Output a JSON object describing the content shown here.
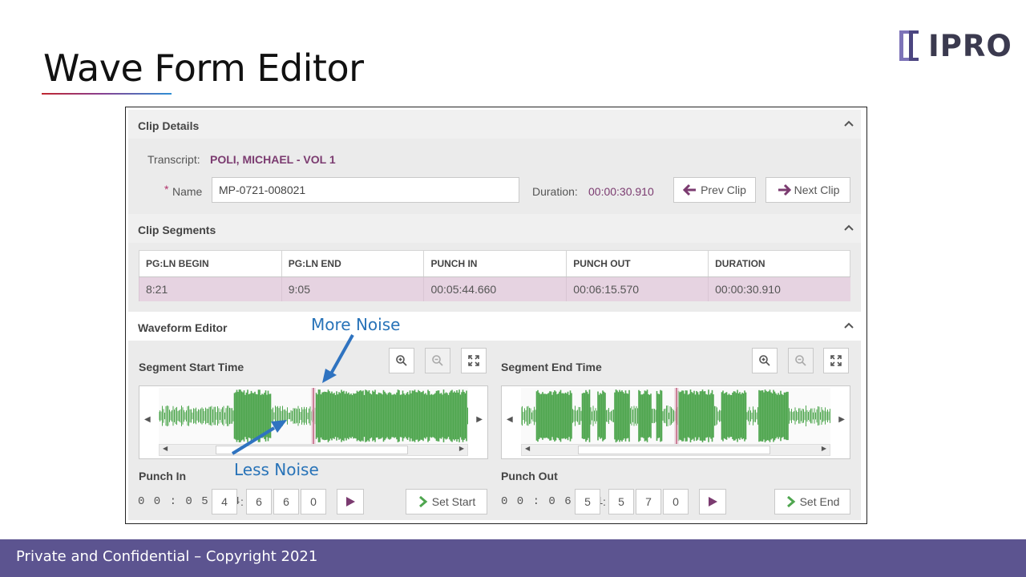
{
  "slide": {
    "title": "Wave Form Editor",
    "logo_text": "IPRO",
    "footer": "Private and Confidential – Copyright 2021"
  },
  "clip_details": {
    "header": "Clip Details",
    "transcript_label": "Transcript:",
    "transcript_value": "POLI, MICHAEL - VOL 1",
    "required_mark": "*",
    "name_label": "Name",
    "name_value": "MP-0721-008021",
    "duration_label": "Duration:",
    "duration_value": "00:00:30.910",
    "prev_clip": "Prev Clip",
    "next_clip": "Next Clip"
  },
  "clip_segments": {
    "header": "Clip Segments",
    "columns": [
      "PG:LN BEGIN",
      "PG:LN END",
      "PUNCH IN",
      "PUNCH OUT",
      "DURATION"
    ],
    "rows": [
      [
        "8:21",
        "9:05",
        "00:05:44.660",
        "00:06:15.570",
        "00:00:30.910"
      ]
    ]
  },
  "waveform_editor": {
    "header": "Waveform Editor",
    "start": {
      "label": "Segment Start Time",
      "punch_label": "Punch  In",
      "time_prefix": "0 0 : 0 5 : 4",
      "digits": [
        "4",
        "6",
        "6",
        "0"
      ],
      "set_button": "Set Start"
    },
    "end": {
      "label": "Segment End Time",
      "punch_label": "Punch  Out",
      "time_prefix": "0 0 : 0 6 : 1",
      "digits": [
        "5",
        "5",
        "7",
        "0"
      ],
      "set_button": "Set End"
    },
    "colon": ":"
  },
  "annotations": {
    "more_noise": "More Noise",
    "less_noise": "Less Noise"
  },
  "colors": {
    "accent_purple": "#7b3b70",
    "wave_green": "#4fa64f",
    "footer_bg": "#5c5490",
    "annotation_blue": "#2873b8",
    "row_highlight": "#e6d3e1"
  },
  "icons": [
    "chevron-up-icon",
    "arrow-left-icon",
    "arrow-right-icon",
    "zoom-in-icon",
    "zoom-out-icon",
    "expand-icon",
    "play-icon",
    "chevron-right-icon"
  ]
}
